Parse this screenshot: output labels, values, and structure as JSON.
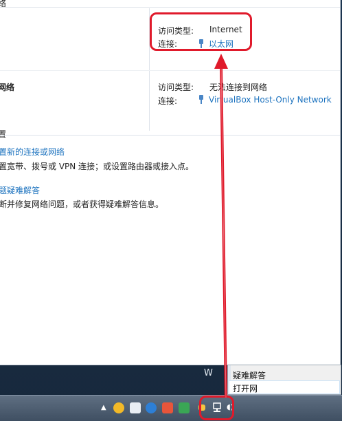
{
  "network_panel": {
    "top_section_fragment": "络",
    "connection_1": {
      "access_type_label": "访问类型:",
      "access_type_value": "Internet",
      "connection_label": "连接:",
      "connection_value": "以太网"
    },
    "network_2_name": "网络",
    "connection_2": {
      "access_type_label": "访问类型:",
      "access_type_value": "无法连接到网络",
      "connection_label": "连接:",
      "connection_value": "VirtualBox Host-Only Network"
    },
    "settings_section_fragment": "置",
    "actions": [
      {
        "title": "置新的连接或网络",
        "description": "置宽带、拨号或 VPN 连接；或设置路由器或接入点。"
      },
      {
        "title": "题疑难解答",
        "description": "断并修复网络问题，或者获得疑难解答信息。"
      }
    ]
  },
  "context_menu": {
    "items": [
      "疑难解答",
      "打开网"
    ]
  },
  "desktop_watermark": "W",
  "colors": {
    "link": "#1d73bf",
    "highlight": "#e01a2b"
  }
}
